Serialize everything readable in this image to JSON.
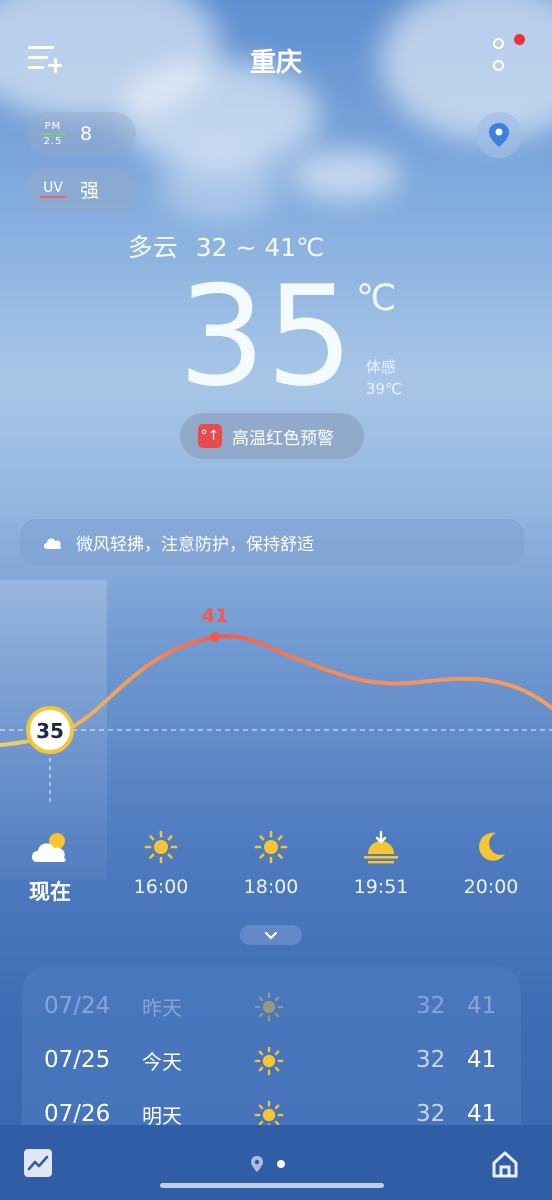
{
  "header": {
    "city": "重庆",
    "menu_icon": "add-city-menu-icon",
    "more_icon": "more-icon"
  },
  "air": {
    "pm_label_top": "PM",
    "pm_label_bottom": "2.5",
    "pm_value": "8",
    "uv_label": "UV",
    "uv_value": "强"
  },
  "current": {
    "condition": "多云",
    "range": "32 ~ 41℃",
    "temp": "35",
    "unit": "℃",
    "feels_label": "体感",
    "feels_value": "39℃",
    "alert": "高温红色预警"
  },
  "tip": "微风轻拂，注意防护，保持舒适",
  "hourly": {
    "now_value": "35",
    "peak_value": "41",
    "items": [
      {
        "time": "现在",
        "icon": "partly-cloudy-icon"
      },
      {
        "time": "16:00",
        "icon": "sun-icon"
      },
      {
        "time": "18:00",
        "icon": "sun-icon"
      },
      {
        "time": "19:51",
        "icon": "sunset-icon"
      },
      {
        "time": "20:00",
        "icon": "moon-icon"
      }
    ]
  },
  "daily": [
    {
      "date": "07/24",
      "day": "昨天",
      "low": "32",
      "high": "41"
    },
    {
      "date": "07/25",
      "day": "今天",
      "low": "32",
      "high": "41"
    },
    {
      "date": "07/26",
      "day": "明天",
      "low": "32",
      "high": "41"
    }
  ],
  "colors": {
    "accent_red": "#f0303a",
    "sun_yellow": "#f7c531",
    "curve_start": "#e9d26a",
    "curve_peak": "#f05a4b"
  }
}
